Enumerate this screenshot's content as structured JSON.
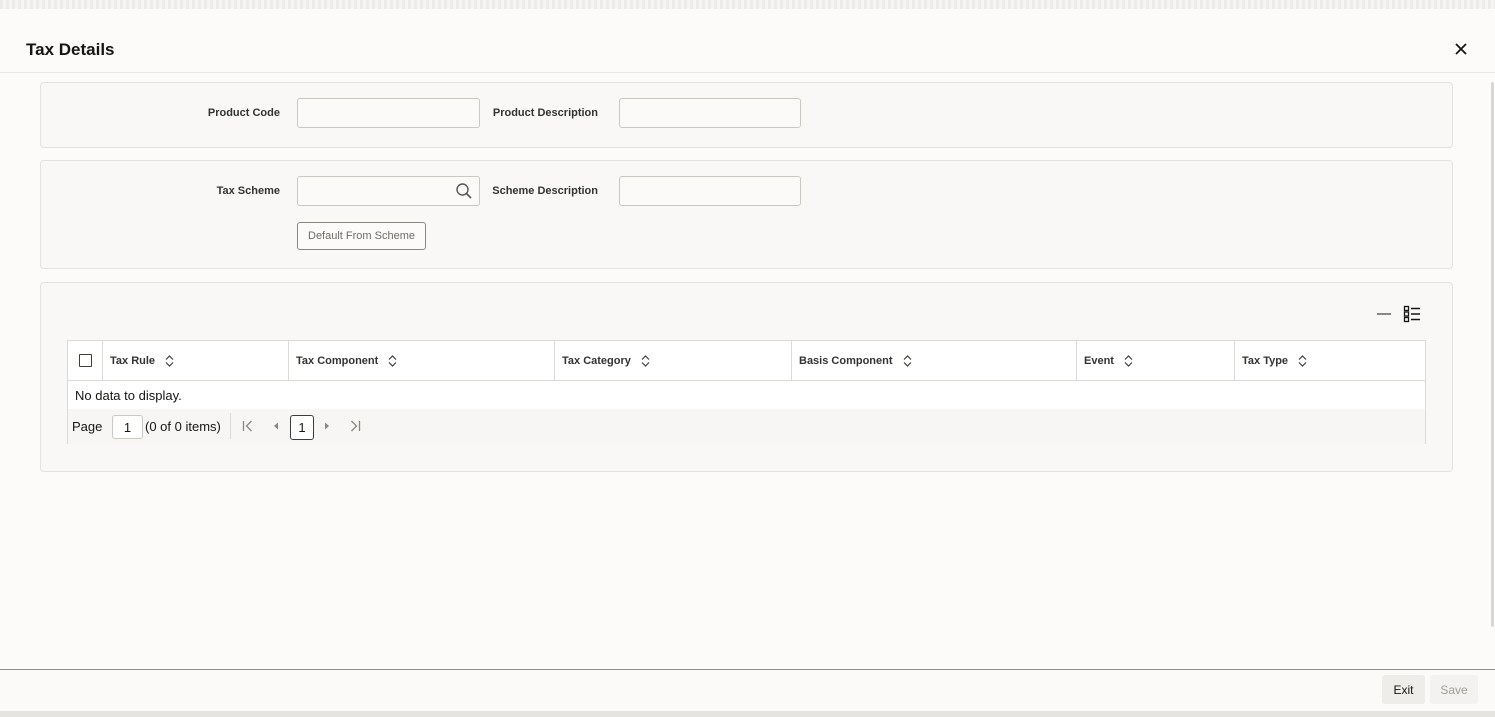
{
  "dialog": {
    "title": "Tax Details"
  },
  "product": {
    "code_label": "Product Code",
    "code_value": "",
    "description_label": "Product Description",
    "description_value": ""
  },
  "scheme": {
    "label": "Tax Scheme",
    "value": "",
    "description_label": "Scheme Description",
    "description_value": "",
    "default_button": "Default From Scheme"
  },
  "table": {
    "columns": [
      "Tax Rule",
      "Tax Component",
      "Tax Category",
      "Basis Component",
      "Event",
      "Tax Type"
    ],
    "empty_message": "No data to display.",
    "pager": {
      "page_label": "Page",
      "page_value": "1",
      "count_text": "(0 of 0 items)",
      "current_page": "1"
    }
  },
  "footer": {
    "exit_label": "Exit",
    "save_label": "Save"
  },
  "icons": {
    "close": "close-icon",
    "search": "search-icon",
    "minimize": "minus-icon",
    "columns": "list-columns-icon",
    "sort": "sort-icon",
    "first": "first-page-icon",
    "prev": "prev-page-icon",
    "next": "next-page-icon",
    "last": "last-page-icon"
  },
  "colors": {
    "text": "#161513",
    "border": "#cbc8c3",
    "disabled_text": "#a19e99"
  }
}
